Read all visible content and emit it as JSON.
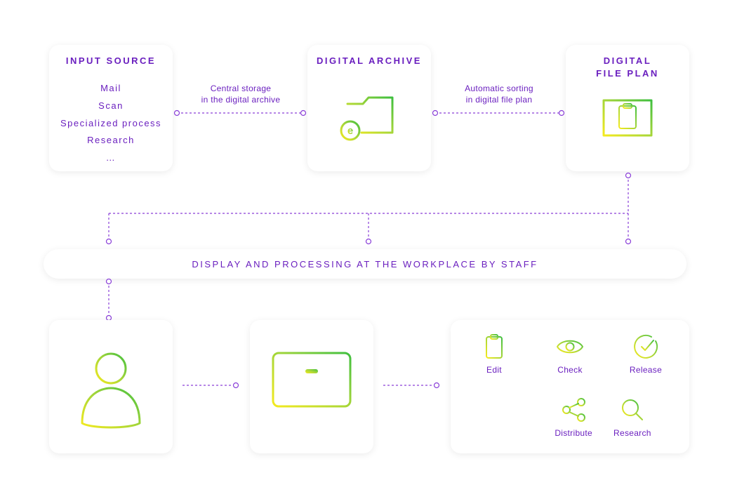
{
  "top": {
    "input_source": {
      "title": "INPUT SOURCE",
      "items": [
        "Mail",
        "Scan",
        "Specialized process",
        "Research",
        "…"
      ]
    },
    "connector1": {
      "line1": "Central storage",
      "line2": "in the digital archive"
    },
    "digital_archive": {
      "title": "DIGITAL ARCHIVE"
    },
    "connector2": {
      "line1": "Automatic sorting",
      "line2": "in digital file plan"
    },
    "digital_file_plan": {
      "title_line1": "DIGITAL",
      "title_line2": "FILE PLAN"
    }
  },
  "bar": {
    "label": "DISPLAY AND PROCESSING AT THE WORKPLACE BY STAFF"
  },
  "bottom": {
    "actions": {
      "edit": "Edit",
      "check": "Check",
      "release": "Release",
      "distribute": "Distribute",
      "research": "Research"
    }
  }
}
